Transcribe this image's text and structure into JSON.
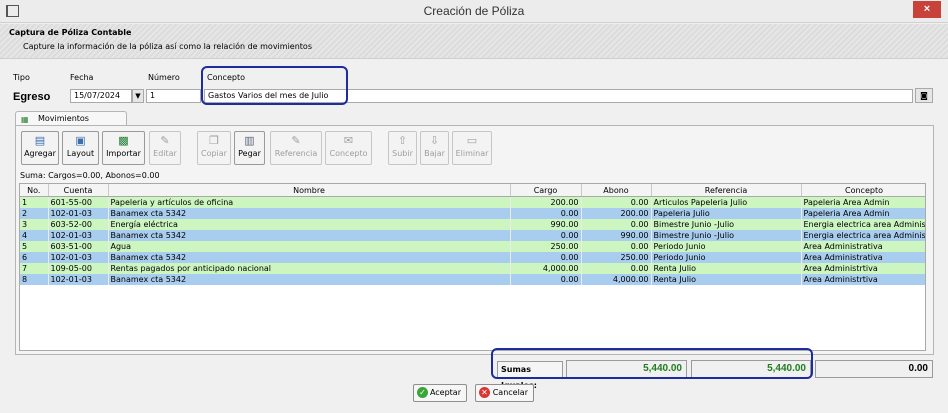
{
  "window": {
    "title": "Creación de Póliza",
    "close_glyph": "×"
  },
  "header": {
    "title": "Captura de Póliza Contable",
    "subtitle": "Capture la información de la póliza así como la relación de movimientos"
  },
  "form": {
    "tipo_label": "Tipo",
    "tipo_value": "Egreso",
    "fecha_label": "Fecha",
    "fecha_value": "15/07/2024",
    "numero_label": "Número",
    "numero_value": "1",
    "concepto_label": "Concepto",
    "concepto_value": "Gastos Varios del mes de Julio"
  },
  "tab": {
    "label": "Movimientos"
  },
  "toolbar": [
    {
      "label": "Agregar",
      "icon": "add-doc-icon",
      "enabled": true
    },
    {
      "label": "Layout",
      "icon": "layout-icon",
      "enabled": true
    },
    {
      "label": "Importar",
      "icon": "excel-icon",
      "enabled": true
    },
    {
      "label": "Editar",
      "icon": "edit-icon",
      "enabled": false
    },
    {
      "label": "Copiar",
      "icon": "copy-icon",
      "enabled": false
    },
    {
      "label": "Pegar",
      "icon": "paste-icon",
      "enabled": true
    },
    {
      "label": "Referencia",
      "icon": "reference-icon",
      "enabled": false
    },
    {
      "label": "Concepto",
      "icon": "concept-icon",
      "enabled": false
    },
    {
      "label": "Subir",
      "icon": "arrow-up-icon",
      "enabled": false
    },
    {
      "label": "Bajar",
      "icon": "arrow-down-icon",
      "enabled": false
    },
    {
      "label": "Eliminar",
      "icon": "delete-icon",
      "enabled": false
    }
  ],
  "sum_line": "Suma: Cargos=0.00, Abonos=0.00",
  "table": {
    "columns": [
      "No.",
      "Cuenta",
      "Nombre",
      "Cargo",
      "Abono",
      "Referencia",
      "Concepto"
    ],
    "rows": [
      [
        "1",
        "601-55-00",
        "Papeleria y artículos de oficina",
        "200.00",
        "0.00",
        "Articulos Papeleria Julio",
        "Papeleria Area Admin"
      ],
      [
        "2",
        "102-01-03",
        "Banamex cta 5342",
        "0.00",
        "200.00",
        "Papeleria Julio",
        "Papeleria Area Admin"
      ],
      [
        "3",
        "603-52-00",
        "Energía eléctrica",
        "990.00",
        "0.00",
        "Bimestre Junio -Julio",
        "Energia electrica area Administrativa"
      ],
      [
        "4",
        "102-01-03",
        "Banamex cta 5342",
        "0.00",
        "990.00",
        "Bimestre Junio -Julio",
        "Energia electrica area Administrativa"
      ],
      [
        "5",
        "603-51-00",
        "Agua",
        "250.00",
        "0.00",
        "Periodo Junio",
        "Area Administrativa"
      ],
      [
        "6",
        "102-01-03",
        "Banamex cta 5342",
        "0.00",
        "250.00",
        "Periodo Junio",
        "Area Administrativa"
      ],
      [
        "7",
        "109-05-00",
        "Rentas pagados por anticipado nacional",
        "4,000.00",
        "0.00",
        "Renta Julio",
        "Area Administrtiva"
      ],
      [
        "8",
        "102-01-03",
        "Banamex cta 5342",
        "0.00",
        "4,000.00",
        "Renta Julio",
        "Area Administrtiva"
      ]
    ]
  },
  "totals": {
    "label": "Sumas Iguales:",
    "cargo": "5,440.00",
    "abono": "5,440.00",
    "diferencia": "0.00"
  },
  "buttons": {
    "accept": "Aceptar",
    "cancel": "Cancelar"
  },
  "colors": {
    "row_green": "#ccf5c0",
    "row_blue": "#a9cdef",
    "highlight": "#1d2c9e",
    "total_green": "#1f7d1f",
    "close_red": "#c9423a"
  }
}
